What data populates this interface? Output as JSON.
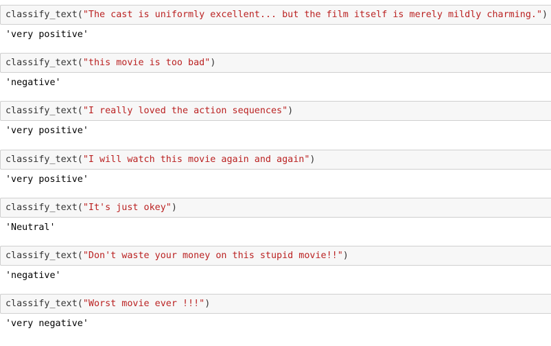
{
  "cells": [
    {
      "fn": "classify_text(",
      "arg": "\"The cast is uniformly excellent... but the film itself is merely mildly charming.\"",
      "close": ")",
      "output": "'very positive'"
    },
    {
      "fn": "classify_text(",
      "arg": "\"this movie is too bad\"",
      "close": ")",
      "output": "'negative'"
    },
    {
      "fn": "classify_text(",
      "arg": "\"I really loved the action sequences\"",
      "close": ")",
      "output": "'very positive'"
    },
    {
      "fn": "classify_text(",
      "arg": "\"I will watch this movie again and again\"",
      "close": ")",
      "output": "'very positive'"
    },
    {
      "fn": "classify_text(",
      "arg": "\"It's just okey\"",
      "close": ")",
      "output": "'Neutral'"
    },
    {
      "fn": "classify_text(",
      "arg": "\"Don't waste your money on this stupid movie!!\"",
      "close": ")",
      "output": "'negative'"
    },
    {
      "fn": "classify_text(",
      "arg": "\"Worst movie ever !!!\"",
      "close": ")",
      "output": "'very negative'"
    }
  ],
  "colors": {
    "input_background": "#f7f7f7",
    "input_border": "#cfcfcf",
    "code_text": "#333333",
    "string_literal": "#ba2121",
    "output_text": "#000000"
  }
}
